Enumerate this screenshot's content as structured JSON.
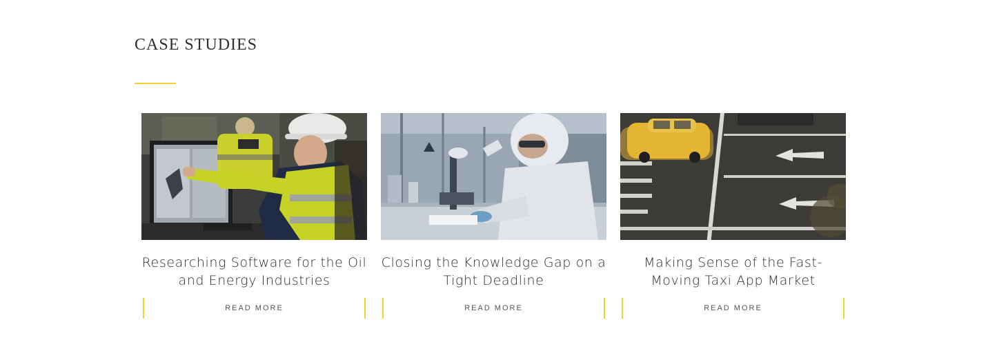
{
  "section": {
    "title": "CASE STUDIES",
    "accent_color": "#f3d22b"
  },
  "cards": [
    {
      "title": "Researching Software for the Oil and Energy Industries",
      "cta": "READ MORE",
      "image": "engineers-at-monitor-photo"
    },
    {
      "title": "Closing the Knowledge Gap on a Tight Deadline",
      "cta": "READ MORE",
      "image": "lab-scientist-microscope-photo"
    },
    {
      "title": "Making Sense of the Fast-Moving Taxi App Market",
      "cta": "READ MORE",
      "image": "yellow-taxi-street-photo"
    }
  ]
}
